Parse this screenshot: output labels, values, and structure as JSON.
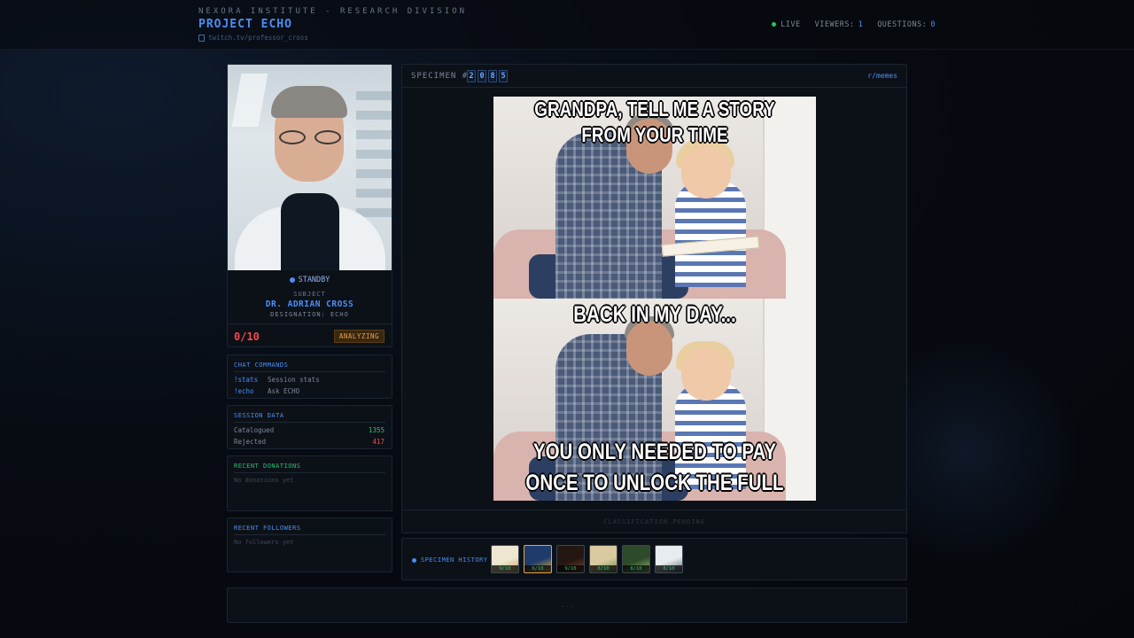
{
  "header": {
    "org": "NEXORA INSTITUTE - RESEARCH DIVISION",
    "project": "PROJECT ECHO",
    "channel": "twitch.tv/professor_cross",
    "live_label": "LIVE",
    "viewers_label": "VIEWERS:",
    "viewers_value": "1",
    "questions_label": "QUESTIONS:",
    "questions_value": "0"
  },
  "profile": {
    "status": "STANDBY",
    "subject_label": "SUBJECT",
    "name": "DR. ADRIAN CROSS",
    "designation": "DESIGNATION: ECHO",
    "score": "0/10",
    "badge": "ANALYZING"
  },
  "commands": {
    "title": "CHAT COMMANDS",
    "items": [
      {
        "cmd": "!stats",
        "desc": "Session stats"
      },
      {
        "cmd": "!echo",
        "desc": "Ask ECHO"
      }
    ]
  },
  "session": {
    "title": "SESSION DATA",
    "catalogued_label": "Catalogued",
    "catalogued_value": "1355",
    "rejected_label": "Rejected",
    "rejected_value": "417"
  },
  "donations": {
    "title": "RECENT DONATIONS",
    "empty": "No donations yet"
  },
  "followers": {
    "title": "RECENT FOLLOWERS",
    "empty": "No followers yet"
  },
  "specimen": {
    "label": "SPECIMEN #",
    "digits": [
      "2",
      "0",
      "8",
      "5"
    ],
    "source": "r/memes",
    "caption_top": "GRANDPA, TELL ME A STORY FROM YOUR TIME",
    "caption_mid": "BACK IN MY DAY...",
    "caption_bottom": "YOU ONLY NEEDED TO PAY ONCE TO UNLOCK THE FULL GAME",
    "pending": "CLASSIFICATION PENDING"
  },
  "history": {
    "label": "SPECIMEN HISTORY",
    "items": [
      {
        "rating": "9/10",
        "bg": "#efe6d2",
        "accent": "#c9a25a"
      },
      {
        "rating": "6/10",
        "bg": "#1f3b6b",
        "accent": "#e2b24a"
      },
      {
        "rating": "9/10",
        "bg": "#241712",
        "accent": "#7b4a2a"
      },
      {
        "rating": "8/10",
        "bg": "#d9caa0",
        "accent": "#6f8a4a"
      },
      {
        "rating": "8/10",
        "bg": "#2d4a2a",
        "accent": "#9bbf6a"
      },
      {
        "rating": "8/10",
        "bg": "#e9ecef",
        "accent": "#5a6470"
      }
    ]
  },
  "footer": {
    "placeholder": "..."
  }
}
